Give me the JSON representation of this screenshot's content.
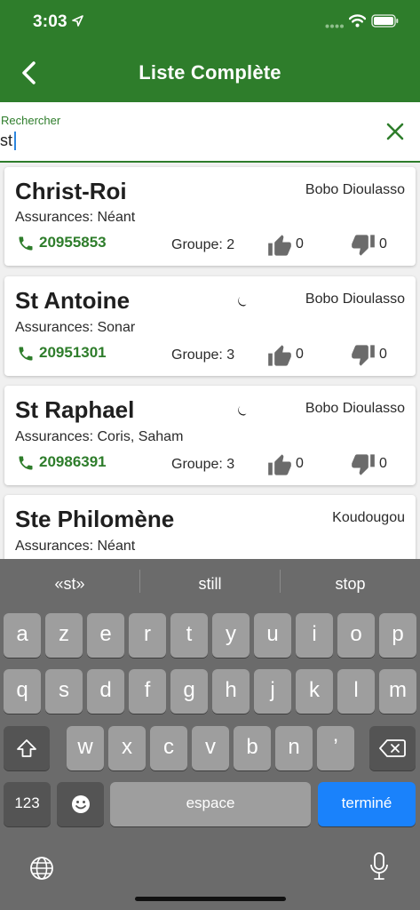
{
  "status": {
    "time": "3:03"
  },
  "nav": {
    "title": "Liste Complète",
    "back_icon": "chevron-left-icon"
  },
  "search": {
    "label": "Rechercher",
    "value": "st",
    "clear_icon": "close-icon"
  },
  "colors": {
    "primary": "#2e7d2b",
    "keyboard_bg": "#6b6b6b",
    "key_bg": "#9e9e9e",
    "done_bg": "#1a82fb"
  },
  "pharmacies": [
    {
      "name": "Christ-Roi",
      "city": "Bobo Dioulasso",
      "insurance": "Assurances: Néant",
      "phone": "20955853",
      "group": "Groupe: 2",
      "likes": "0",
      "dislikes": "0",
      "night": false
    },
    {
      "name": "St Antoine",
      "city": "Bobo Dioulasso",
      "insurance": "Assurances: Sonar",
      "phone": "20951301",
      "group": "Groupe: 3",
      "likes": "0",
      "dislikes": "0",
      "night": true
    },
    {
      "name": "St Raphael",
      "city": "Bobo Dioulasso",
      "insurance": "Assurances: Coris, Saham",
      "phone": "20986391",
      "group": "Groupe: 3",
      "likes": "0",
      "dislikes": "0",
      "night": true
    },
    {
      "name": "Ste Philomène",
      "city": "Koudougou",
      "insurance": "Assurances: Néant"
    }
  ],
  "keyboard": {
    "suggestions": [
      "«st»",
      "still",
      "stop"
    ],
    "row1": [
      "a",
      "z",
      "e",
      "r",
      "t",
      "y",
      "u",
      "i",
      "o",
      "p"
    ],
    "row2": [
      "q",
      "s",
      "d",
      "f",
      "g",
      "h",
      "j",
      "k",
      "l",
      "m"
    ],
    "row3": [
      "w",
      "x",
      "c",
      "v",
      "b",
      "n",
      "’"
    ],
    "numbers_label": "123",
    "space_label": "espace",
    "done_label": "terminé"
  }
}
